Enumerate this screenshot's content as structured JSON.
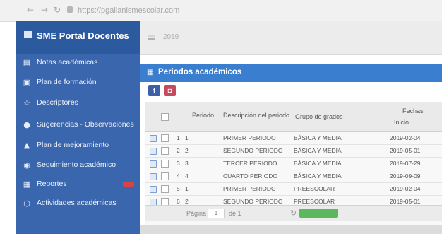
{
  "browser": {
    "url": "https://pgallanismescolar.com"
  },
  "sidebar": {
    "brand": "SME Portal Docentes",
    "items": [
      {
        "label": "Notas académicas",
        "icon": "book-icon"
      },
      {
        "label": "Plan de formación",
        "icon": "file-icon"
      },
      {
        "label": "Descriptores",
        "icon": "star-icon"
      },
      {
        "label": "Sugerencias - Observaciones",
        "icon": "comment-icon"
      },
      {
        "label": "Plan de mejoramiento",
        "icon": "thumbs-up-icon"
      },
      {
        "label": "Seguimiento académico",
        "icon": "eye-icon"
      },
      {
        "label": "Reportes",
        "icon": "chart-icon"
      },
      {
        "label": "Actividades académicas",
        "icon": "circle-icon"
      }
    ]
  },
  "topbar": {
    "year": "2019"
  },
  "panel": {
    "title": "Periodos académicos"
  },
  "toolbar": {
    "fb_label": "f",
    "pdf_label": "◘"
  },
  "table": {
    "headers": {
      "periodo": "Periodo",
      "descripcion": "Descripción del periodo",
      "grupo": "Grupo de grados",
      "fechas": "Fechas",
      "inicio": "Inicio"
    },
    "rows": [
      {
        "n": "1",
        "periodo": "1",
        "descripcion": "PRIMER PERIODO",
        "grupo": "BÁSICA Y MEDIA",
        "inicio": "2019-02-04"
      },
      {
        "n": "2",
        "periodo": "2",
        "descripcion": "SEGUNDO PERIODO",
        "grupo": "BÁSICA Y MEDIA",
        "inicio": "2019-05-01"
      },
      {
        "n": "3",
        "periodo": "3",
        "descripcion": "TERCER PERIODO",
        "grupo": "BÁSICA Y MEDIA",
        "inicio": "2019-07-29"
      },
      {
        "n": "4",
        "periodo": "4",
        "descripcion": "CUARTO PERIODO",
        "grupo": "BÁSICA Y MEDIA",
        "inicio": "2019-09-09"
      },
      {
        "n": "5",
        "periodo": "1",
        "descripcion": "PRIMER PERIODO",
        "grupo": "PREESCOLAR",
        "inicio": "2019-02-04"
      },
      {
        "n": "6",
        "periodo": "2",
        "descripcion": "SEGUNDO PERIODO",
        "grupo": "PREESCOLAR",
        "inicio": "2019-05-01"
      }
    ]
  },
  "pager": {
    "label": "Página",
    "page": "1",
    "of": "de 1"
  }
}
